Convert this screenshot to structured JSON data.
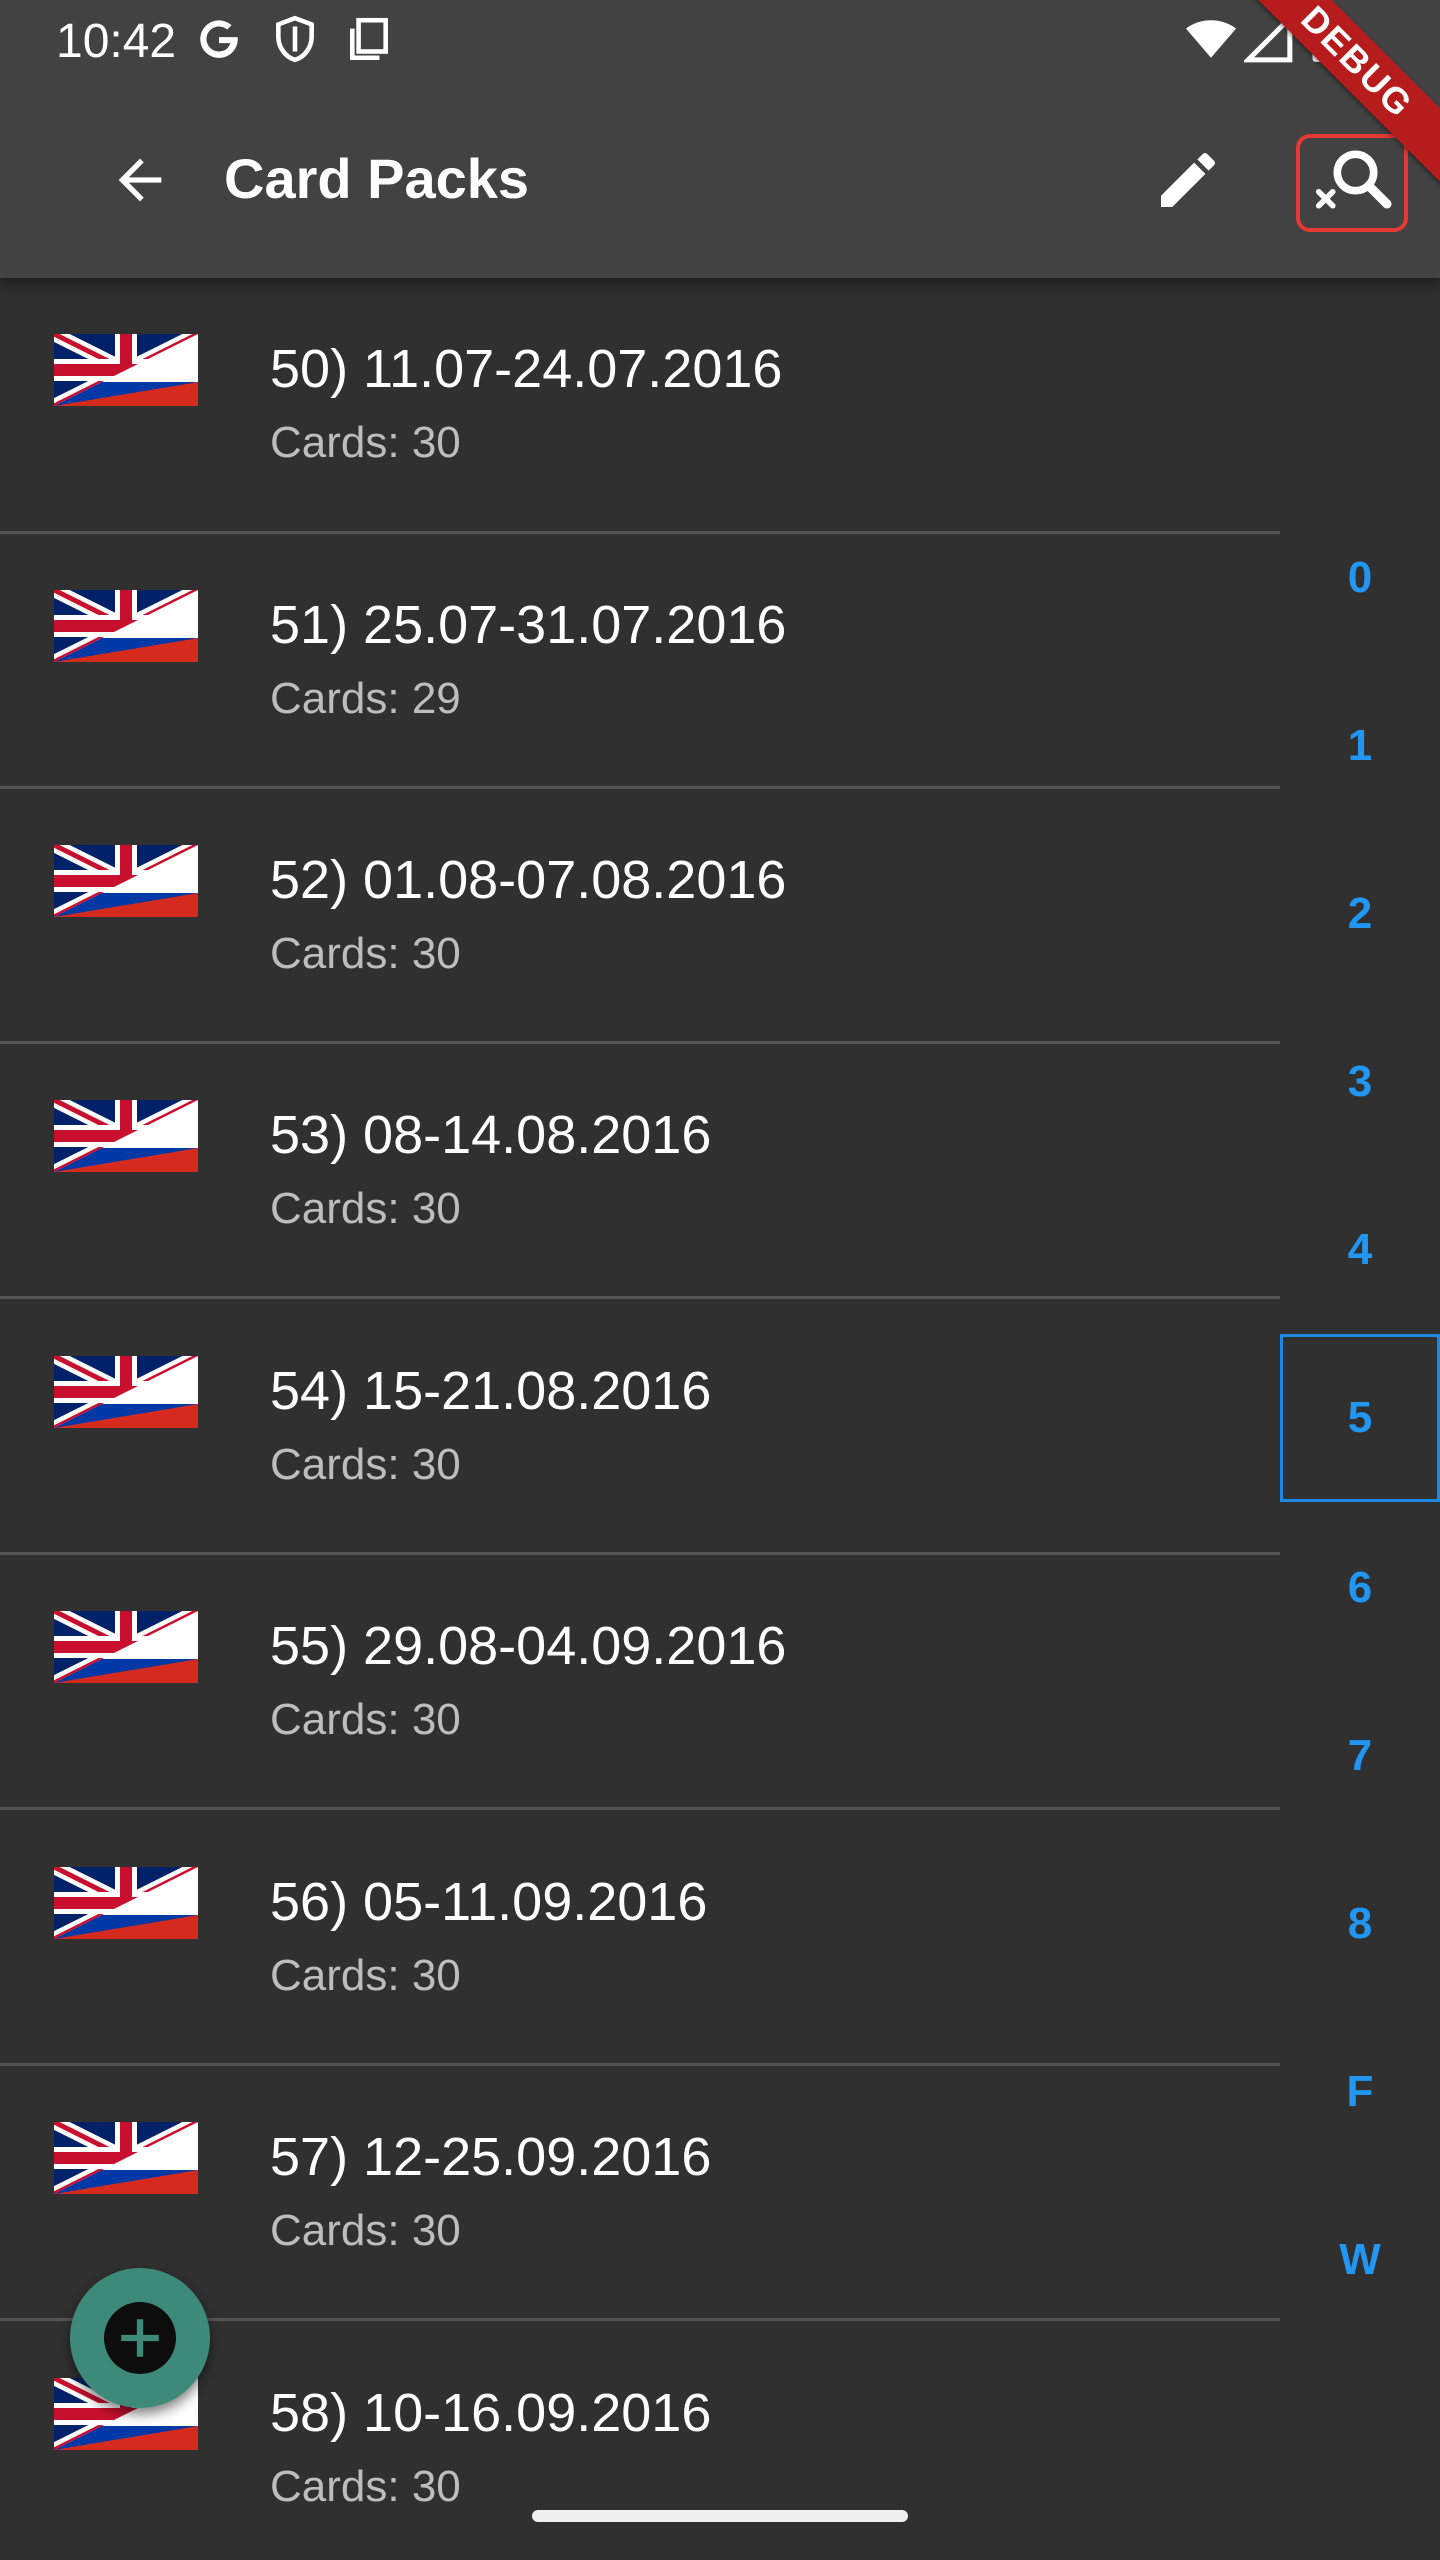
{
  "status_bar": {
    "time": "10:42",
    "left_icons": [
      "google-g-icon",
      "shield-icon",
      "screenshot-icon"
    ],
    "right_icons": [
      "wifi-icon",
      "signal-icon",
      "battery-icon"
    ]
  },
  "debug_banner": {
    "label": "DEBUG"
  },
  "app_bar": {
    "title": "Card Packs",
    "back_icon": "arrow-back-icon",
    "edit_icon": "pencil-icon",
    "search_clear_icon": "search-off-icon"
  },
  "list": {
    "items": [
      {
        "title": "50) 11.07-24.07.2016",
        "subtitle": "Cards: 30",
        "flag": "en-ru"
      },
      {
        "title": "51) 25.07-31.07.2016",
        "subtitle": "Cards: 29",
        "flag": "en-ru"
      },
      {
        "title": "52) 01.08-07.08.2016",
        "subtitle": "Cards: 30",
        "flag": "en-ru"
      },
      {
        "title": "53) 08-14.08.2016",
        "subtitle": "Cards: 30",
        "flag": "en-ru"
      },
      {
        "title": "54) 15-21.08.2016",
        "subtitle": "Cards: 30",
        "flag": "en-ru"
      },
      {
        "title": "55) 29.08-04.09.2016",
        "subtitle": "Cards: 30",
        "flag": "en-ru"
      },
      {
        "title": "56) 05-11.09.2016",
        "subtitle": "Cards: 30",
        "flag": "en-ru"
      },
      {
        "title": "57) 12-25.09.2016",
        "subtitle": "Cards: 30",
        "flag": "en-ru"
      },
      {
        "title": "58) 10-16.09.2016",
        "subtitle": "Cards: 30",
        "flag": "en-ru"
      }
    ]
  },
  "index_rail": {
    "items": [
      "0",
      "1",
      "2",
      "3",
      "4",
      "5",
      "6",
      "7",
      "8",
      "F",
      "W"
    ],
    "selected": "5"
  },
  "fab": {
    "icon": "add-icon"
  },
  "colors": {
    "background": "#303030",
    "app_bar": "#424242",
    "accent": "#2196f3",
    "fab": "#3d8a78",
    "debug": "#b71c1c",
    "search_highlight": "#e53935"
  }
}
